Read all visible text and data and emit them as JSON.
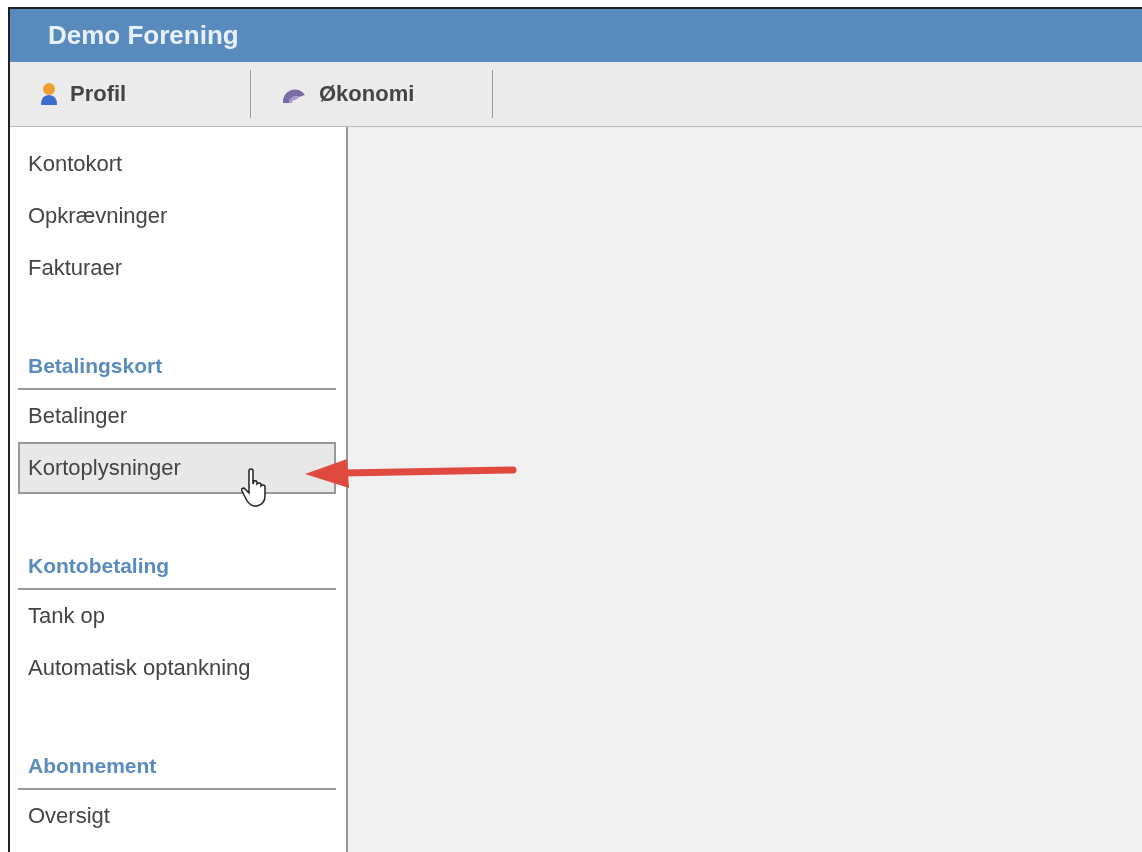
{
  "header": {
    "title": "Demo Forening"
  },
  "tabs": [
    {
      "label": "Profil",
      "kind": "person"
    },
    {
      "label": "Økonomi",
      "kind": "swirl"
    }
  ],
  "sidebar": {
    "groups": [
      {
        "items": [
          {
            "label": "Kontokort",
            "selected": false
          },
          {
            "label": "Opkrævninger",
            "selected": false
          },
          {
            "label": "Fakturaer",
            "selected": false
          }
        ]
      },
      {
        "heading": "Betalingskort",
        "items": [
          {
            "label": "Betalinger",
            "selected": false
          },
          {
            "label": "Kortoplysninger",
            "selected": true
          }
        ]
      },
      {
        "heading": "Kontobetaling",
        "items": [
          {
            "label": "Tank op",
            "selected": false
          },
          {
            "label": "Automatisk optankning",
            "selected": false
          }
        ]
      },
      {
        "heading": "Abonnement",
        "items": [
          {
            "label": "Oversigt",
            "selected": false
          }
        ]
      }
    ]
  }
}
